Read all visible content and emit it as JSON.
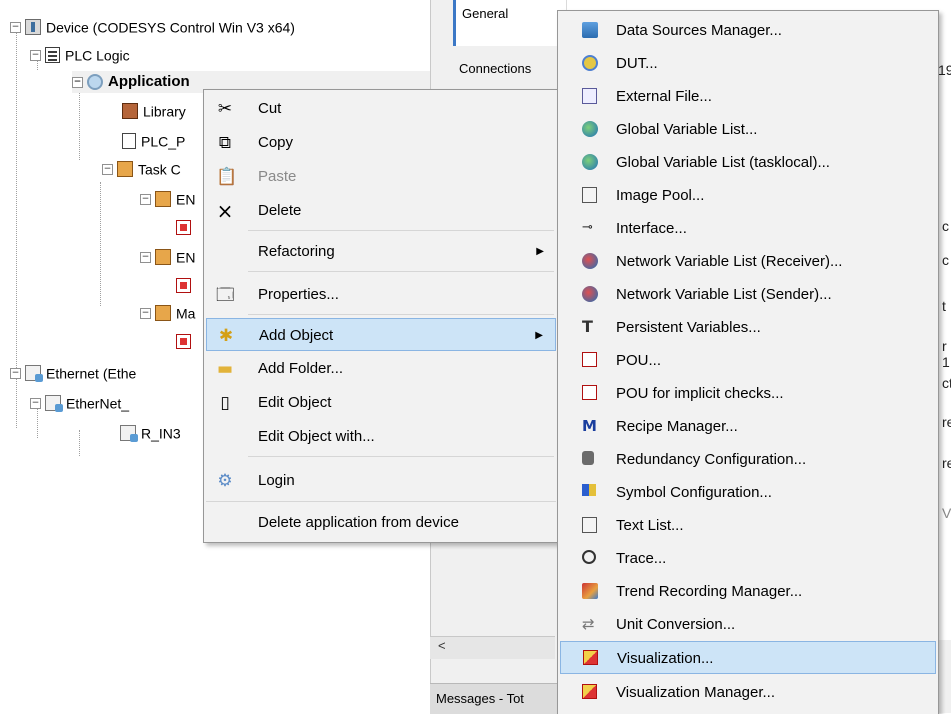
{
  "tree": {
    "device": "Device (CODESYS Control Win V3 x64)",
    "plc_logic": "PLC Logic",
    "application": "Application",
    "library": "Library",
    "plc_prg": "PLC_P",
    "task_config": "Task C",
    "task1": "EN",
    "task2": "EN",
    "task3": "Ma",
    "ethernet": "Ethernet (Ethe",
    "ethernet_ip": "EtherNet_",
    "r_in": "R_IN3"
  },
  "editor": {
    "tab_general": "General",
    "tab_connections": "Connections",
    "frag_19": "19",
    "frag_c1": "c",
    "frag_c2": "c",
    "frag_t": "t",
    "frag_r1": "r 1",
    "frag_ct": "ct",
    "frag_re1": "re",
    "frag_re2": "re",
    "frag_v": "V",
    "scroll_left": "<",
    "messages": "Messages - Tot"
  },
  "context_menu": {
    "items": [
      {
        "label": "Cut",
        "icon": "scissors-icon",
        "enabled": true
      },
      {
        "label": "Copy",
        "icon": "copy-icon",
        "enabled": true
      },
      {
        "label": "Paste",
        "icon": "paste-icon",
        "enabled": false
      },
      {
        "label": "Delete",
        "icon": "delete-icon",
        "enabled": true
      },
      {
        "label": "Refactoring",
        "icon": "",
        "submenu": true
      },
      {
        "label": "Properties...",
        "icon": "properties-icon"
      },
      {
        "label": "Add Object",
        "icon": "add-object-icon",
        "submenu": true,
        "highlighted": true
      },
      {
        "label": "Add Folder...",
        "icon": "folder-icon"
      },
      {
        "label": "Edit Object",
        "icon": "edit-object-icon"
      },
      {
        "label": "Edit Object with...",
        "icon": ""
      },
      {
        "label": "Login",
        "icon": "login-icon"
      },
      {
        "label": "Delete application from device",
        "icon": ""
      }
    ]
  },
  "submenu": {
    "items": [
      {
        "label": "Data Sources Manager...",
        "icon": "data-sources-icon"
      },
      {
        "label": "DUT...",
        "icon": "dut-icon"
      },
      {
        "label": "External File...",
        "icon": "external-file-icon"
      },
      {
        "label": "Global Variable List...",
        "icon": "global-variable-list-icon"
      },
      {
        "label": "Global Variable List (tasklocal)...",
        "icon": "gvl-tasklocal-icon"
      },
      {
        "label": "Image Pool...",
        "icon": "image-pool-icon"
      },
      {
        "label": "Interface...",
        "icon": "interface-icon"
      },
      {
        "label": "Network Variable List (Receiver)...",
        "icon": "nvl-receiver-icon"
      },
      {
        "label": "Network Variable List (Sender)...",
        "icon": "nvl-sender-icon"
      },
      {
        "label": "Persistent Variables...",
        "icon": "persistent-variables-icon"
      },
      {
        "label": "POU...",
        "icon": "pou-icon"
      },
      {
        "label": "POU for implicit checks...",
        "icon": "pou-implicit-icon"
      },
      {
        "label": "Recipe Manager...",
        "icon": "recipe-manager-icon"
      },
      {
        "label": "Redundancy Configuration...",
        "icon": "redundancy-icon"
      },
      {
        "label": "Symbol Configuration...",
        "icon": "symbol-configuration-icon"
      },
      {
        "label": "Text List...",
        "icon": "text-list-icon"
      },
      {
        "label": "Trace...",
        "icon": "trace-icon"
      },
      {
        "label": "Trend Recording Manager...",
        "icon": "trend-recording-icon"
      },
      {
        "label": "Unit Conversion...",
        "icon": "unit-conversion-icon"
      },
      {
        "label": "Visualization...",
        "icon": "visualization-icon",
        "highlighted": true
      },
      {
        "label": "Visualization Manager...",
        "icon": "visualization-manager-icon"
      }
    ]
  },
  "colors": {
    "highlight_bg": "#cde4f7",
    "highlight_border": "#8ab5e3",
    "menu_bg": "#f2f2f2"
  }
}
